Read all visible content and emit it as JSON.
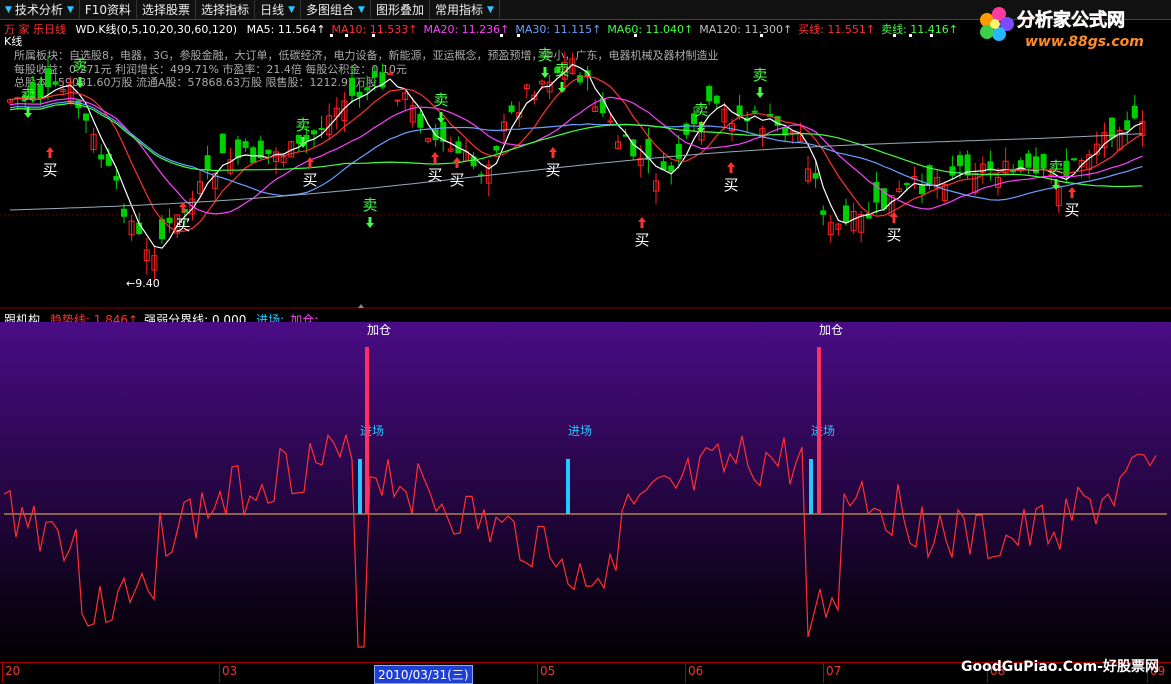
{
  "toolbar": {
    "items": [
      {
        "label": "技术分析",
        "dropdown": true
      },
      {
        "label": "F10资料",
        "dropdown": false
      },
      {
        "label": "选择股票",
        "dropdown": false
      },
      {
        "label": "选择指标",
        "dropdown": false
      },
      {
        "label": "日线",
        "dropdown": true
      },
      {
        "label": "多图组合",
        "dropdown": true
      },
      {
        "label": "图形叠加",
        "dropdown": false
      },
      {
        "label": "常用指标",
        "dropdown": true
      }
    ]
  },
  "logo": {
    "title": "分析家公式网",
    "url": "www.88gs.com"
  },
  "ma_bar": {
    "period_title": "万 家 乐日线",
    "wd_label": "WD.K线(0,5,10,20,30,60,120)",
    "items": [
      {
        "text": "MA5: 11.564↑",
        "color": "#ffffff"
      },
      {
        "text": "MA10: 11.533↑",
        "color": "#ff3030"
      },
      {
        "text": "MA20: 11.236↑",
        "color": "#ff40ff"
      },
      {
        "text": "MA30: 11.115↑",
        "color": "#6aa0ff"
      },
      {
        "text": "MA60: 11.040↑",
        "color": "#40ff40"
      },
      {
        "text": "MA120: 11.300↑",
        "color": "#c0c0c0"
      },
      {
        "text": "买线: 11.551↑",
        "color": "#ff3030"
      },
      {
        "text": "卖线: 11.416↑",
        "color": "#40ff40"
      }
    ]
  },
  "kline_label": "K线",
  "stock_info": {
    "line1": "所属板块：自选股8，电器，3G，参股金融，大订单，低碳经济，电力设备，新能源，亚运概念，预盈预增，中小，广东，电器机械及器材制造业",
    "line2": "每股收益：0.271元   利润增长：499.71%   市盈率：21.4倍   每股公积金：0.10元",
    "line3": "总股本：59081.60万股   流通A股：57868.63万股   限售股：1212.97万股"
  },
  "price_low_label": "←9.40",
  "signals": {
    "buy": "买",
    "sell": "卖"
  },
  "indicator": {
    "name": "跟机构",
    "items": [
      {
        "text": "趋势线: 1.846↑",
        "color": "#ff3030"
      },
      {
        "text": "强弱分界线: 0.000,",
        "color": "#ffffff"
      },
      {
        "text": "进场:",
        "color": "#29c7ff"
      },
      {
        "text": "加仓:",
        "color": "#ff40ff"
      }
    ],
    "entry_label": "进场",
    "add_label": "加仓"
  },
  "x_axis": {
    "ticks": [
      "20",
      "03",
      "05",
      "06",
      "07",
      "08",
      "09"
    ],
    "cursor_date": "2010/03/31(三)"
  },
  "watermark": "GoodGuPiao.Com-好股票网",
  "colors": {
    "bg": "#000000",
    "up": "#ff2020",
    "down": "#00d000",
    "panel_top": "#4a0c86",
    "panel_bottom": "#000000"
  }
}
